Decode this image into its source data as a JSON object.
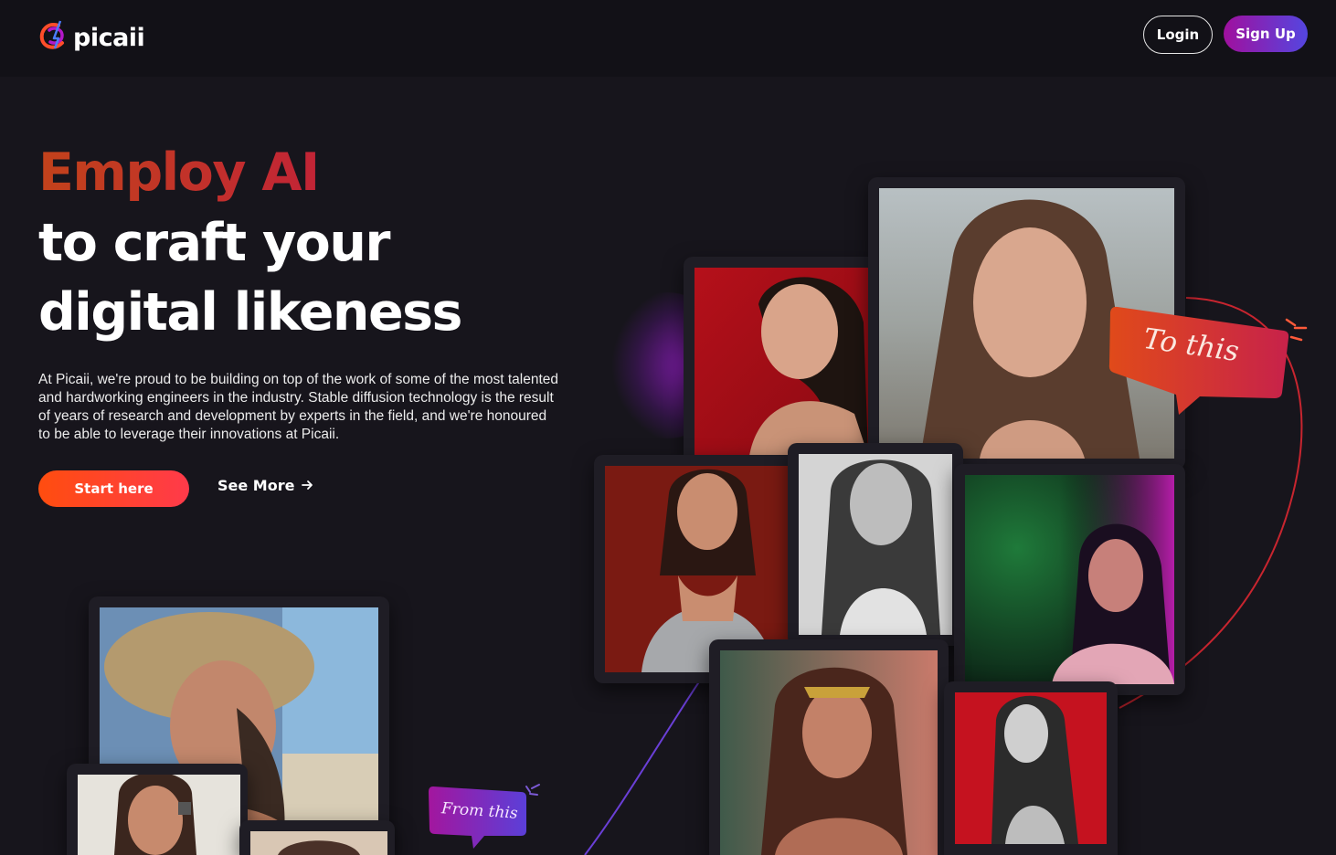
{
  "header": {
    "brand": "picaii",
    "login_label": "Login",
    "signup_label": "Sign Up"
  },
  "hero": {
    "headline_accent": "Employ AI",
    "headline_line2": "to craft your",
    "headline_line3": "digital likeness",
    "description": "At Picaii, we're proud to be building on top of the work of some of the most talented and hardworking engineers in the industry. Stable diffusion technology is the result of years of research and development by experts in the field, and we're honoured to be able to leverage their innovations at Picaii.",
    "start_label": "Start here",
    "see_more_label": "See More"
  },
  "annotations": {
    "to_this": "To this",
    "from_this": "From this"
  },
  "colors": {
    "background": "#17151c",
    "topbar": "#121117",
    "accent_orange": "#ff4d0f",
    "accent_purple": "#a0109e",
    "accent_blue": "#5446e0",
    "headline_gradient_start": "#c2421b",
    "headline_gradient_end": "#c22436"
  }
}
